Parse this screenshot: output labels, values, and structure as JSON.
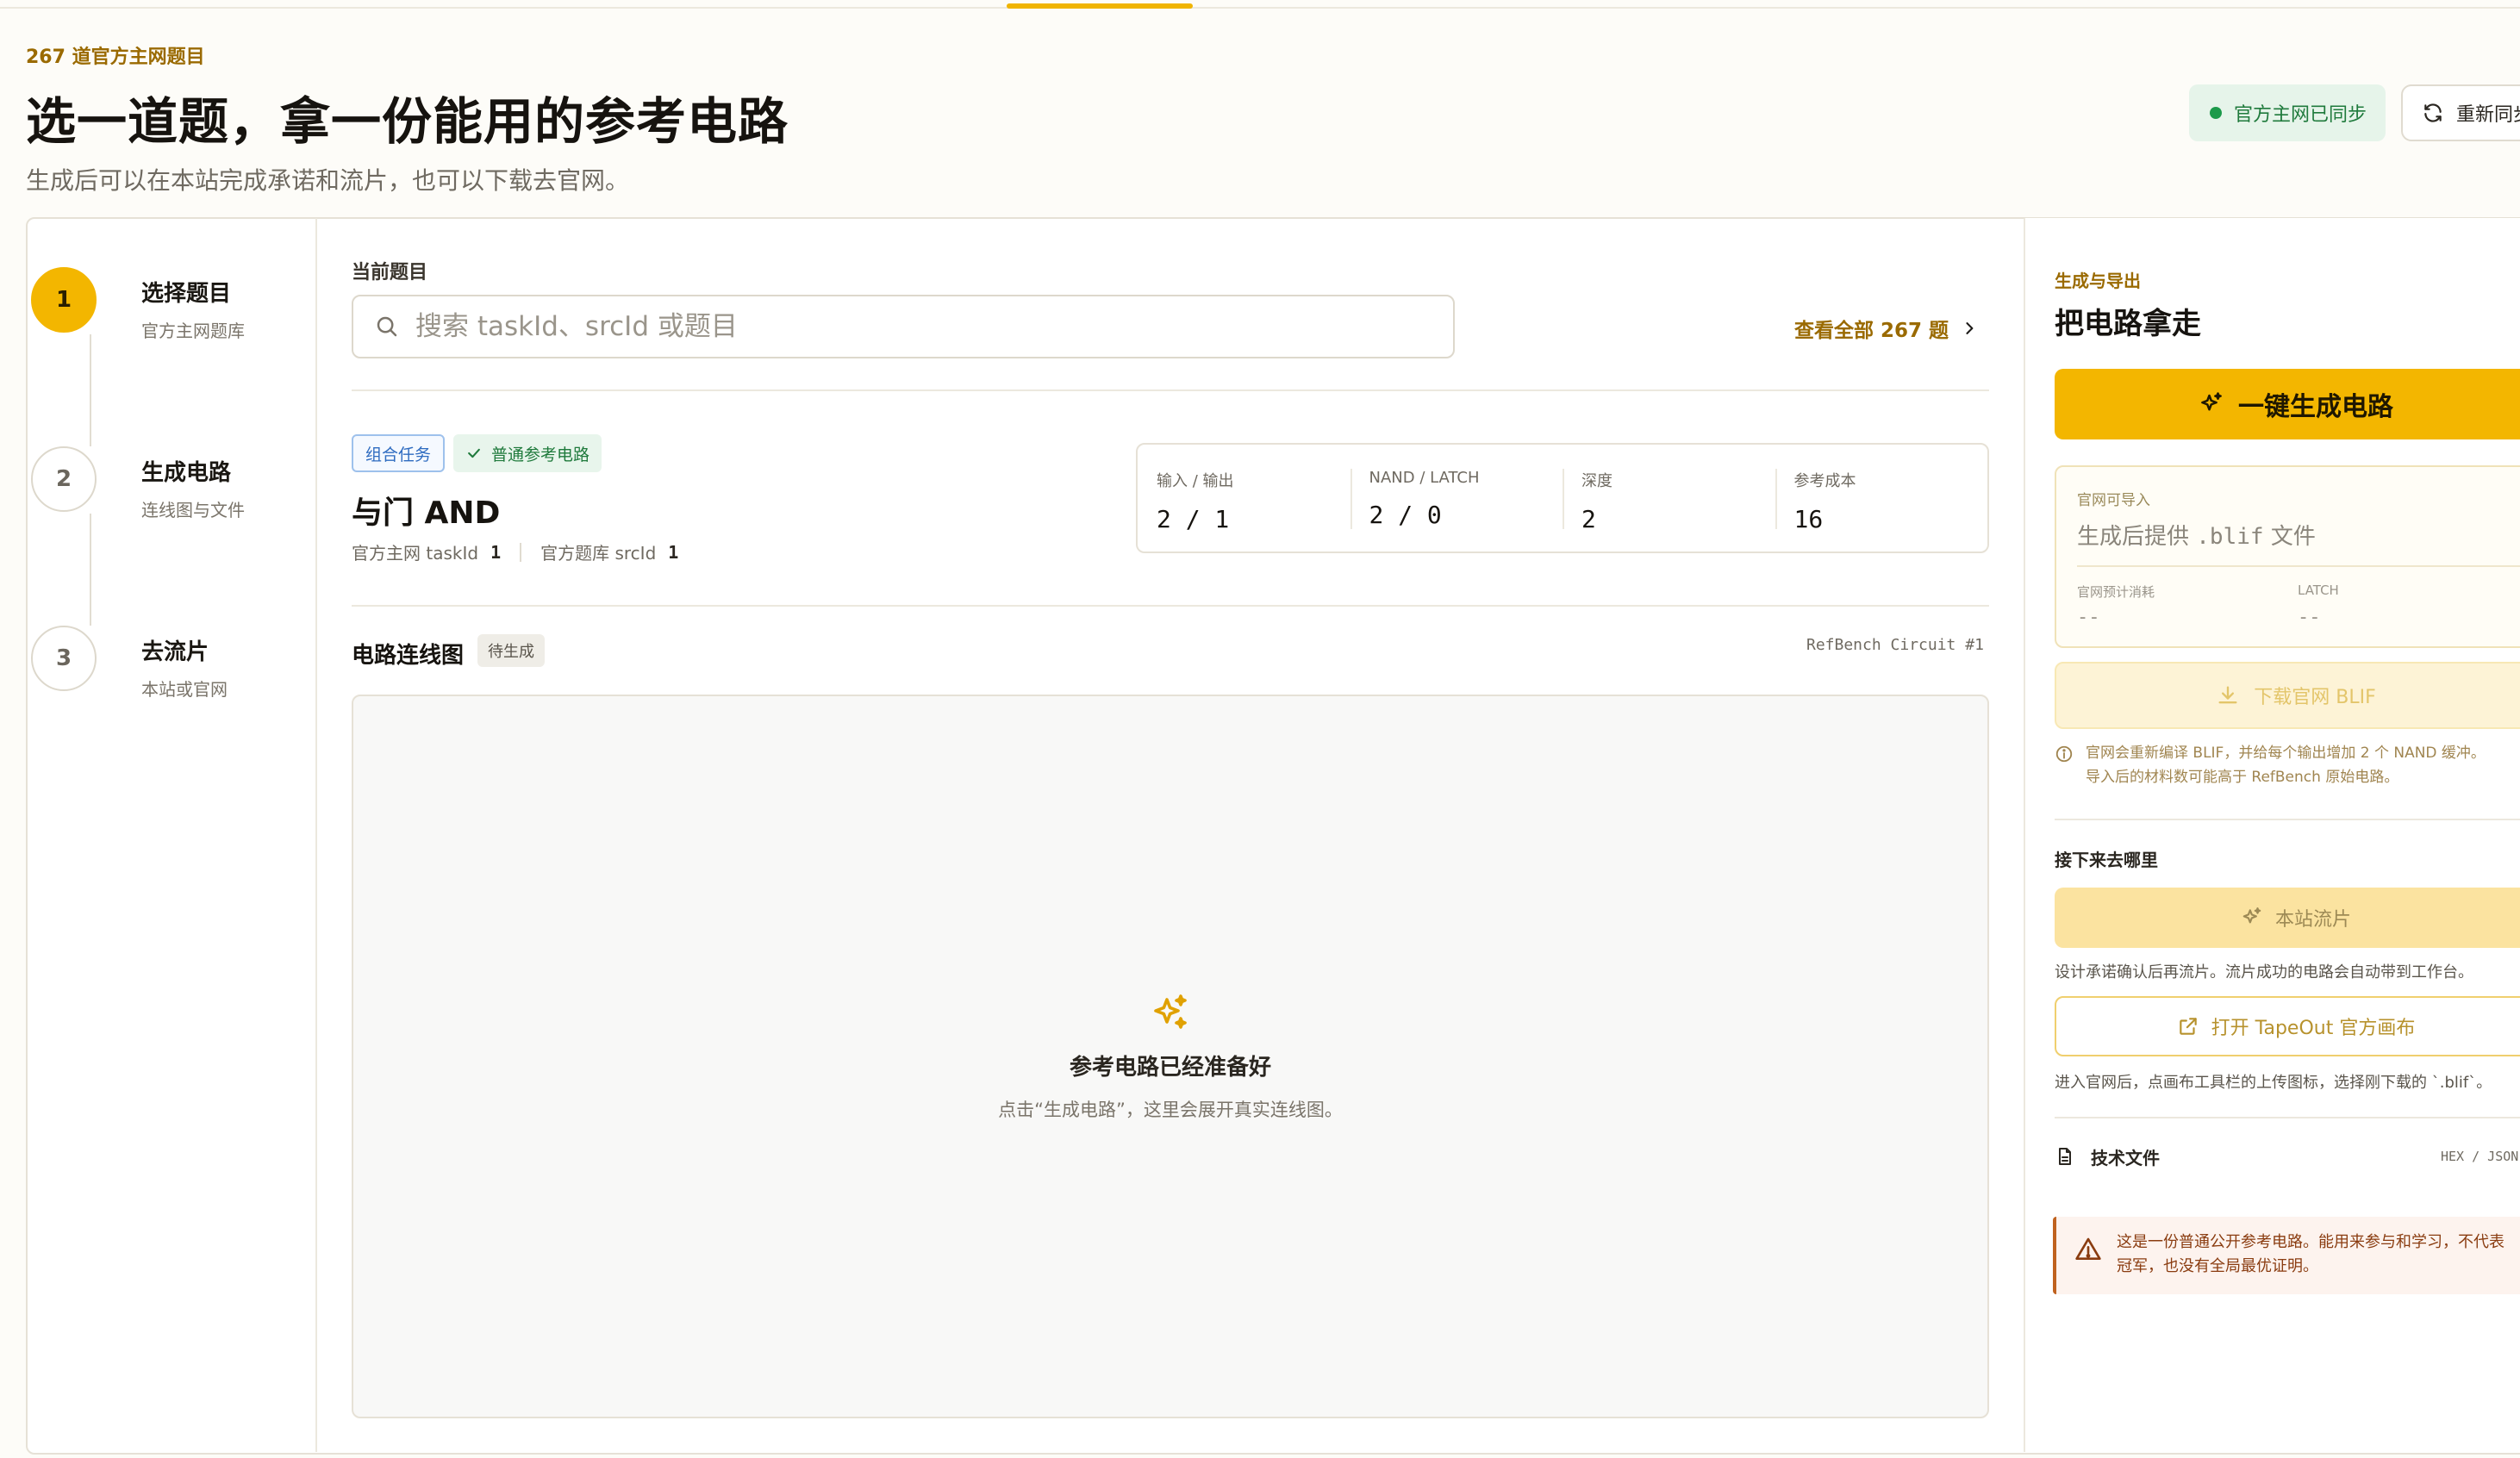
{
  "header": {
    "kicker": "267 道官方主网题目",
    "title": "选一道题，拿一份能用的参考电路",
    "subtitle": "生成后可以在本站完成承诺和流片，也可以下载去官网。",
    "sync_status": "官方主网已同步",
    "resync_label": "重新同步"
  },
  "steps": [
    {
      "number": "1",
      "title": "选择题目",
      "subtitle": "官方主网题库"
    },
    {
      "number": "2",
      "title": "生成电路",
      "subtitle": "连线图与文件"
    },
    {
      "number": "3",
      "title": "去流片",
      "subtitle": "本站或官网"
    }
  ],
  "main": {
    "current_label": "当前题目",
    "search_placeholder": "搜索 taskId、srcId 或题目",
    "view_all": "查看全部 267 题",
    "tags": {
      "type": "组合任务",
      "circuit": "普通参考电路"
    },
    "task_title": "与门 AND",
    "task_id_label": "官方主网 taskId",
    "task_id": "1",
    "src_id_label": "官方题库 srcId",
    "src_id": "1",
    "stats": [
      {
        "label": "输入 / 输出",
        "value": "2 / 1"
      },
      {
        "label": "NAND / LATCH",
        "value": "2 / 0"
      },
      {
        "label": "深度",
        "value": "2"
      },
      {
        "label": "参考成本",
        "value": "16"
      }
    ],
    "diagram": {
      "title": "电路连线图",
      "status": "待生成",
      "ref_label": "RefBench Circuit #1",
      "empty_title": "参考电路已经准备好",
      "empty_sub": "点击“生成电路”，这里会展开真实连线图。"
    }
  },
  "export": {
    "kicker": "生成与导出",
    "title": "把电路拿走",
    "generate_label": "一键生成电路",
    "import_label": "官网可导入",
    "import_text_prefix": "生成后提供",
    "import_ext": ".blif",
    "import_text_suffix": "文件",
    "cost_label": "官网预计消耗",
    "cost_value": "--",
    "latch_label": "LATCH",
    "latch_value": "--",
    "download_label": "下载官网 BLIF",
    "note_line1": "官网会重新编译 BLIF，并给每个输出增加 2 个 NAND 缓冲。",
    "note_line2": "导入后的材料数可能高于 RefBench 原始电路。",
    "next_label": "接下来去哪里",
    "tapeout_label": "本站流片",
    "tapeout_caption": "设计承诺确认后再流片。流片成功的电路会自动带到工作台。",
    "canvas_label": "打开 TapeOut 官方画布",
    "canvas_caption": "进入官网后，点画布工具栏的上传图标，选择刚下载的 `.blif`。",
    "docs_label": "技术文件",
    "docs_formats": "HEX / JSON",
    "warning_line1": "这是一份普通公开参考电路。能用来参与和学习，不代表",
    "warning_line2": "冠军，也没有全局最优证明。"
  },
  "colors": {
    "accent": "#f3b600",
    "accent_text": "#9a6a00",
    "success": "#1c9a4a",
    "warning": "#c0621f"
  }
}
